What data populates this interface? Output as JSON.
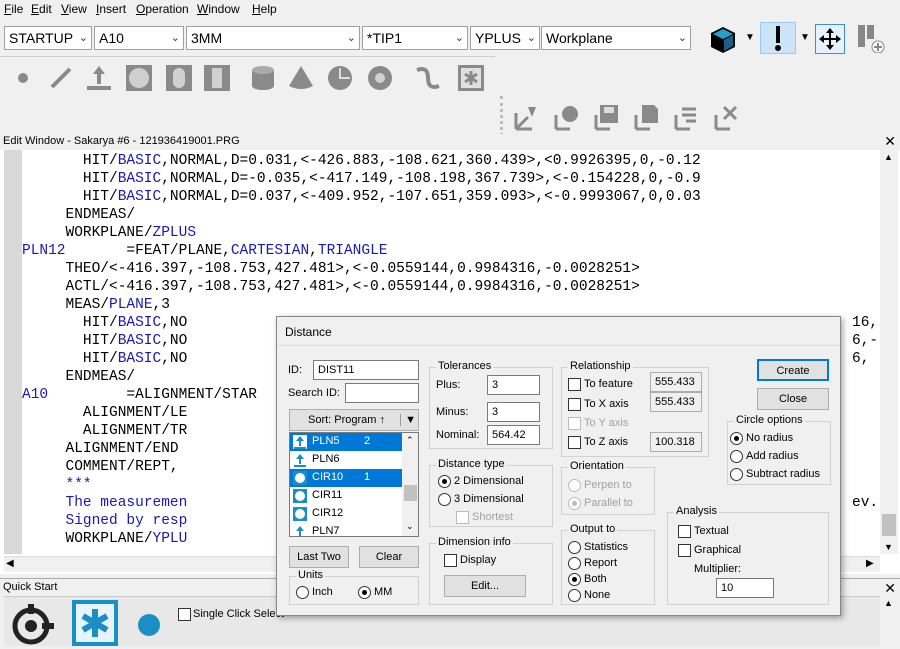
{
  "menubar": {
    "items": [
      "File",
      "Edit",
      "View",
      "Insert",
      "Operation",
      "Window",
      "Help"
    ]
  },
  "combos": {
    "probe": "STARTUP",
    "alignment": "A10",
    "tip_size": "3MM",
    "tip": "*TIP1",
    "probe_dir": "YPLUS",
    "view": "Workplane"
  },
  "edit_window": {
    "title": "Edit Window - Sakarya #6 - 121936419001.PRG",
    "lines": [
      {
        "indent": "       ",
        "parts": [
          [
            "HIT/",
            0
          ],
          [
            "BASIC",
            1
          ],
          [
            ",NORMAL,D=0.031,<-426.883,-108.621,360.439>,<0.9926395,0,-0.12",
            0
          ]
        ]
      },
      {
        "indent": "       ",
        "parts": [
          [
            "HIT/",
            0
          ],
          [
            "BASIC",
            1
          ],
          [
            ",NORMAL,D=-0.035,<-417.149,-108.198,367.739>,<-0.154228,0,-0.9",
            0
          ]
        ]
      },
      {
        "indent": "       ",
        "parts": [
          [
            "HIT/",
            0
          ],
          [
            "BASIC",
            1
          ],
          [
            ",NORMAL,D=0.037,<-409.952,-107.651,359.093>,<-0.9993067,0,0.03",
            0
          ]
        ]
      },
      {
        "indent": "     ",
        "parts": [
          [
            "ENDMEAS/",
            0
          ]
        ]
      },
      {
        "indent": "     ",
        "parts": [
          [
            "WORKPLANE/",
            0
          ],
          [
            "ZPLUS",
            1
          ]
        ]
      },
      {
        "indent": "",
        "parts": [
          [
            "PLN12",
            1
          ],
          [
            "       =FEAT/PLANE,",
            0
          ],
          [
            "CARTESIAN",
            1
          ],
          [
            ",",
            0
          ],
          [
            "TRIANGLE",
            1
          ]
        ]
      },
      {
        "indent": "     ",
        "parts": [
          [
            "THEO/<-416.397,-108.753,427.481>,<-0.0559144,0.9984316,-0.0028251>",
            0
          ]
        ]
      },
      {
        "indent": "     ",
        "parts": [
          [
            "ACTL/<-416.397,-108.753,427.481>,<-0.0559144,0.9984316,-0.0028251>",
            0
          ]
        ]
      },
      {
        "indent": "     ",
        "parts": [
          [
            "MEAS/",
            0
          ],
          [
            "PLANE",
            1
          ],
          [
            ",3",
            0
          ]
        ]
      },
      {
        "indent": "       ",
        "parts": [
          [
            "HIT/",
            0
          ],
          [
            "BASIC",
            1
          ],
          [
            ",NO",
            0
          ]
        ]
      },
      {
        "indent": "       ",
        "parts": [
          [
            "HIT/",
            0
          ],
          [
            "BASIC",
            1
          ],
          [
            ",NO",
            0
          ]
        ]
      },
      {
        "indent": "       ",
        "parts": [
          [
            "HIT/",
            0
          ],
          [
            "BASIC",
            1
          ],
          [
            ",NO",
            0
          ]
        ]
      },
      {
        "indent": "     ",
        "parts": [
          [
            "ENDMEAS/",
            0
          ]
        ]
      },
      {
        "indent": "",
        "parts": [
          [
            "A10",
            1
          ],
          [
            "         =ALIGNMENT/STAR",
            0
          ]
        ]
      },
      {
        "indent": "       ",
        "parts": [
          [
            "ALIGNMENT/LE",
            0
          ]
        ]
      },
      {
        "indent": "       ",
        "parts": [
          [
            "ALIGNMENT/TR",
            0
          ]
        ]
      },
      {
        "indent": "     ",
        "parts": [
          [
            "ALIGNMENT/END",
            0
          ]
        ]
      },
      {
        "indent": "     ",
        "parts": [
          [
            "COMMENT/REPT,",
            0
          ]
        ]
      },
      {
        "indent": "     ",
        "parts": [
          [
            "***",
            1
          ]
        ]
      },
      {
        "indent": "     ",
        "parts": [
          [
            "The measuremen",
            1
          ]
        ]
      },
      {
        "indent": "     ",
        "parts": [
          [
            "Signed by resp",
            1
          ]
        ]
      },
      {
        "indent": "     ",
        "parts": [
          [
            "WORKPLANE/",
            0
          ],
          [
            "YPLU",
            1
          ]
        ]
      }
    ],
    "right_fragments": [
      "16,",
      "6,-",
      "6,",
      "ev."
    ]
  },
  "quick_start": {
    "title": "Quick Start",
    "single_click": "Single Click Select"
  },
  "dialog": {
    "title": "Distance",
    "id_label": "ID:",
    "id_value": "DIST11",
    "search_label": "Search ID:",
    "search_value": "",
    "sort_label": "Sort: Program ↑",
    "features": [
      {
        "name": "PLN5",
        "count": "2",
        "type": "plane",
        "selected": true
      },
      {
        "name": "PLN6",
        "count": "",
        "type": "plane",
        "selected": false
      },
      {
        "name": "CIR10",
        "count": "1",
        "type": "circle",
        "selected": true
      },
      {
        "name": "CIR11",
        "count": "",
        "type": "circle",
        "selected": false
      },
      {
        "name": "CIR12",
        "count": "",
        "type": "circle",
        "selected": false
      },
      {
        "name": "PLN7",
        "count": "",
        "type": "plane",
        "selected": false
      }
    ],
    "last_two": "Last Two",
    "clear": "Clear",
    "units": {
      "title": "Units",
      "inch": "Inch",
      "mm": "MM",
      "selected": "mm"
    },
    "tolerances": {
      "title": "Tolerances",
      "plus_label": "Plus:",
      "plus": "3",
      "minus_label": "Minus:",
      "minus": "3",
      "nominal_label": "Nominal:",
      "nominal": "564.42"
    },
    "distance_type": {
      "title": "Distance type",
      "two_d": "2 Dimensional",
      "three_d": "3 Dimensional",
      "shortest": "Shortest",
      "selected": "2d"
    },
    "dimension_info": {
      "title": "Dimension info",
      "display": "Display",
      "edit": "Edit..."
    },
    "relationship": {
      "title": "Relationship",
      "to_feature": "To feature",
      "to_x": "To X axis",
      "to_y": "To Y axis",
      "to_z": "To Z axis",
      "v_feature": "555.433",
      "v_x": "555.433",
      "v_z": "100.318"
    },
    "orientation": {
      "title": "Orientation",
      "perpen": "Perpen to",
      "parallel": "Parallel to"
    },
    "output": {
      "title": "Output to",
      "statistics": "Statistics",
      "report": "Report",
      "both": "Both",
      "none": "None",
      "selected": "both"
    },
    "create": "Create",
    "close": "Close",
    "circle_options": {
      "title": "Circle options",
      "no_radius": "No radius",
      "add_radius": "Add radius",
      "subtract_radius": "Subtract radius",
      "selected": "no_radius"
    },
    "analysis": {
      "title": "Analysis",
      "textual": "Textual",
      "graphical": "Graphical",
      "multiplier_label": "Multiplier:",
      "multiplier": "10"
    }
  }
}
